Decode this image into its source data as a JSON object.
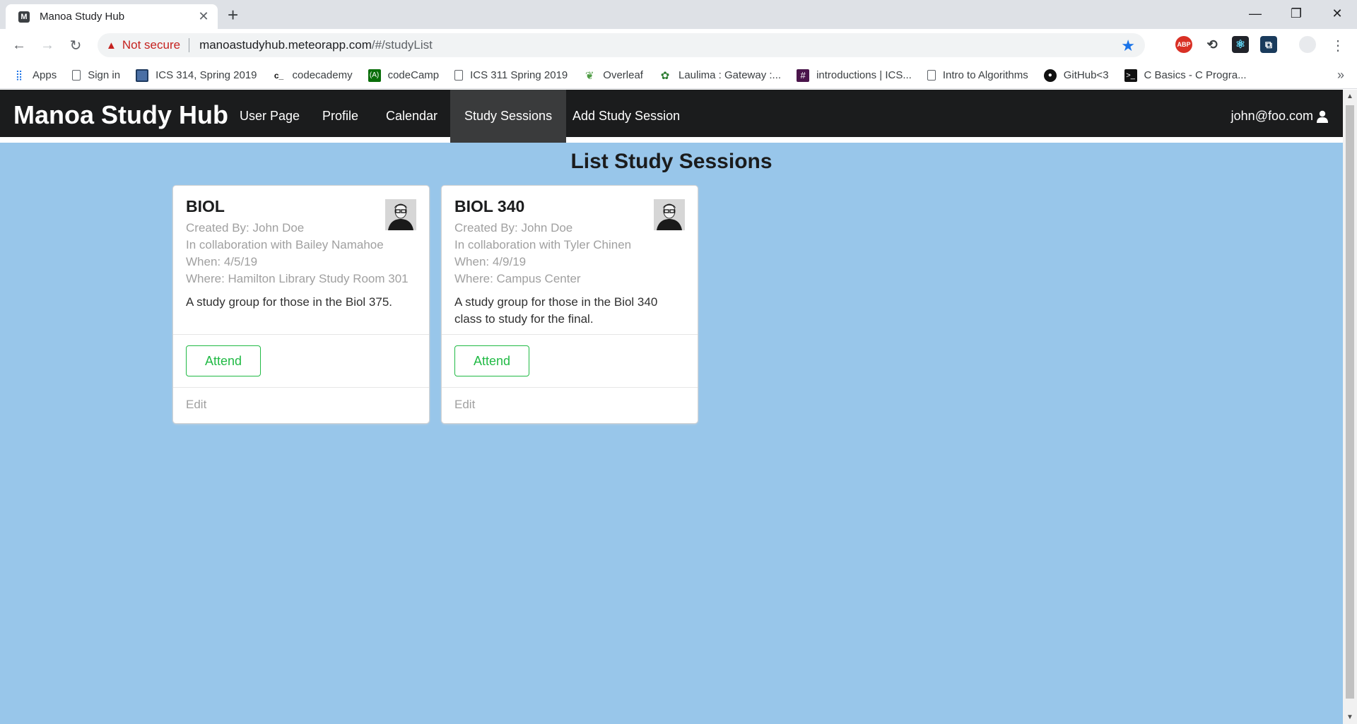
{
  "browser": {
    "tab_title": "Manoa Study Hub",
    "tab_favicon": "M",
    "security_label": "Not secure",
    "url_host": "manoastudyhub.meteorapp.com",
    "url_path": "/#/studyList",
    "extensions": [
      "ABP",
      "sync",
      "react",
      "ext",
      "profile"
    ]
  },
  "bookmarks": [
    {
      "label": "Apps",
      "icon": "apps-grid-icon"
    },
    {
      "label": "Sign in",
      "icon": "page-icon"
    },
    {
      "label": "ICS 314, Spring 2019",
      "icon": "square-icon"
    },
    {
      "label": "codecademy",
      "icon": "codecademy-icon"
    },
    {
      "label": "codeCamp",
      "icon": "codecamp-icon"
    },
    {
      "label": "ICS 311 Spring 2019",
      "icon": "page-icon"
    },
    {
      "label": "Overleaf",
      "icon": "leaf-icon"
    },
    {
      "label": "Laulima : Gateway :...",
      "icon": "laulima-icon"
    },
    {
      "label": "introductions | ICS...",
      "icon": "slack-icon"
    },
    {
      "label": "Intro to Algorithms",
      "icon": "page-icon"
    },
    {
      "label": "GitHub<3",
      "icon": "github-icon"
    },
    {
      "label": "C Basics - C Progra...",
      "icon": "terminal-icon"
    }
  ],
  "navbar": {
    "brand": "Manoa Study Hub",
    "items": [
      "User Page",
      "Profile",
      "Calendar",
      "Study Sessions",
      "Add Study Session"
    ],
    "active": "Study Sessions",
    "user": "john@foo.com"
  },
  "page": {
    "title": "List Study Sessions"
  },
  "sessions": [
    {
      "header": "BIOL",
      "created_by": "Created By: John Doe",
      "collaboration": "In collaboration with Bailey Namahoe",
      "when": "When: 4/5/19",
      "where": "Where: Hamilton Library Study Room 301",
      "description": "A study group for those in the Biol 375.",
      "attend_label": "Attend",
      "edit_label": "Edit"
    },
    {
      "header": "BIOL 340",
      "created_by": "Created By: John Doe",
      "collaboration": "In collaboration with Tyler Chinen",
      "when": "When: 4/9/19",
      "where": "Where: Campus Center",
      "description": "A study group for those in the Biol 340 class to study for the final.",
      "attend_label": "Attend",
      "edit_label": "Edit"
    }
  ],
  "colors": {
    "page_background": "#98c6ea",
    "navbar": "#1b1c1d",
    "attend_green": "#21ba45"
  }
}
